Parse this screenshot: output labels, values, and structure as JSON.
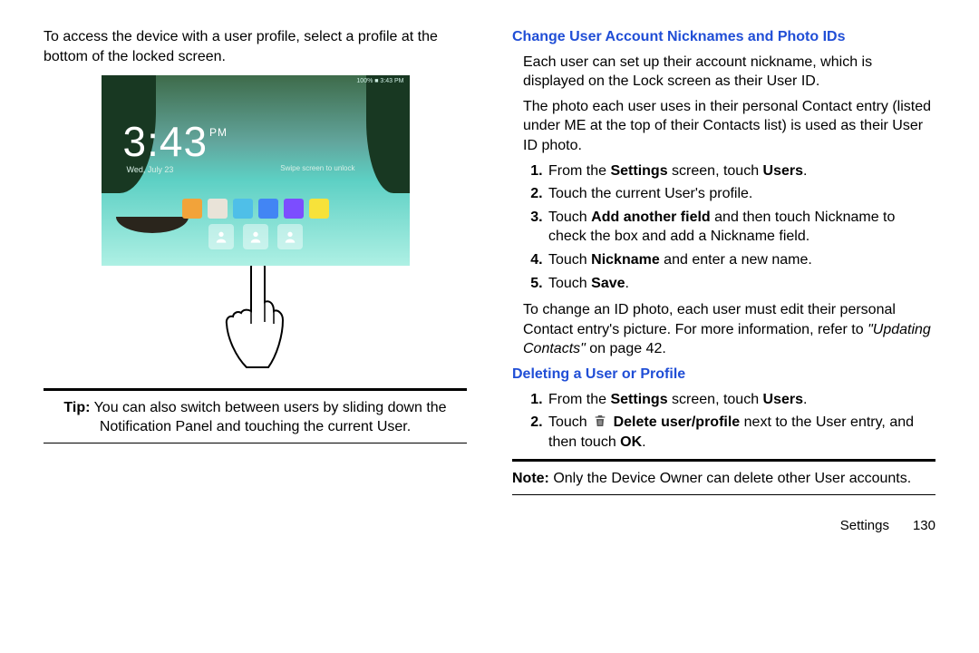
{
  "left": {
    "intro": "To access the device with a user profile, select a profile at the bottom of the locked screen.",
    "tip_label": "Tip:",
    "tip_text": " You can also switch between users by sliding down the Notification Panel and touching the current User.",
    "lockscreen": {
      "status": "100% ■ 3:43 PM",
      "time": "3:43",
      "pm": "PM",
      "date": "Wed, July 23",
      "swipe": "Swipe screen to unlock"
    }
  },
  "right": {
    "h1": "Change User Account Nicknames and Photo IDs",
    "p1": "Each user can set up their account nickname, which is displayed on the Lock screen as their User ID.",
    "p2": "The photo each user uses in their personal Contact entry (listed under ME at the top of their Contacts list) is used as their User ID photo.",
    "steps": {
      "s1a": "From the ",
      "s1b": "Settings",
      "s1c": " screen, touch ",
      "s1d": "Users",
      "s1e": ".",
      "s2": "Touch the current User's profile.",
      "s3a": "Touch ",
      "s3b": "Add another field",
      "s3c": " and then touch Nickname to check the box and add a Nickname field.",
      "s4a": "Touch ",
      "s4b": "Nickname",
      "s4c": " and enter a new name.",
      "s5a": "Touch ",
      "s5b": "Save",
      "s5c": "."
    },
    "p3": "To change an ID photo, each user must edit their personal Contact entry's picture. For more information, refer to ",
    "p3i": "\"Updating Contacts\"",
    "p3t": " on page 42.",
    "h2": "Deleting a User or Profile",
    "del": {
      "s1a": "From the ",
      "s1b": "Settings",
      "s1c": " screen, touch ",
      "s1d": "Users",
      "s1e": ".",
      "s2a": "Touch ",
      "s2b": "Delete user/profile",
      "s2c": " next to the User entry, and then touch ",
      "s2d": "OK",
      "s2e": "."
    },
    "note_label": "Note:",
    "note_text": " Only the Device Owner can delete other User accounts."
  },
  "footer": {
    "section": "Settings",
    "page": "130"
  },
  "colors": {
    "tiles": [
      "#f2a33a",
      "#e9e3d8",
      "#4fbfe8",
      "#4285f4",
      "#7c4dff",
      "#f7e23a"
    ]
  }
}
